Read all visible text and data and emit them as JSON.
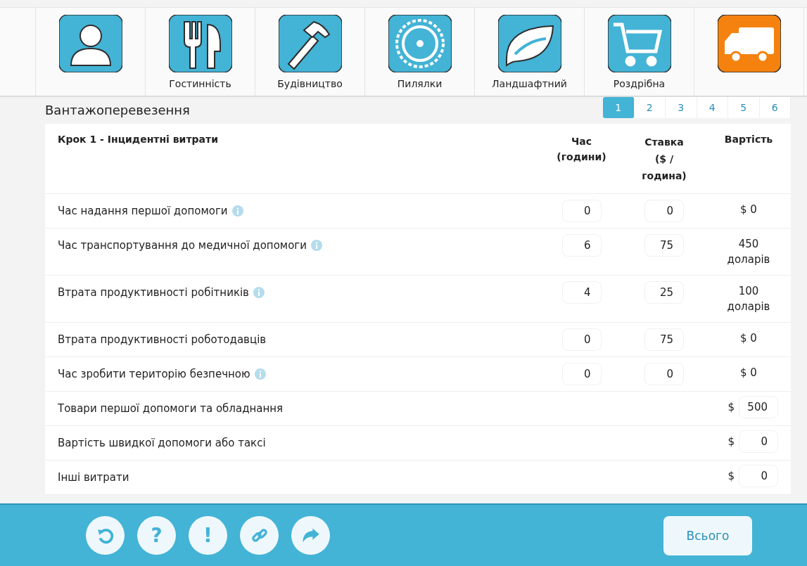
{
  "categories": [
    {
      "selected": false
    },
    {
      "label": "Гостинність",
      "selected": false
    },
    {
      "label": "Будівництво",
      "selected": false
    },
    {
      "label": "Пилялки",
      "selected": false
    },
    {
      "label": "Ландшафтний",
      "selected": false
    },
    {
      "label": "Роздрібна",
      "selected": false
    },
    {
      "selected": true
    }
  ],
  "title": "Вантажоперевезення",
  "pages": [
    {
      "label": "1",
      "selected": true
    },
    {
      "label": "2",
      "selected": false
    },
    {
      "label": "3",
      "selected": false
    },
    {
      "label": "4",
      "selected": false
    },
    {
      "label": "5",
      "selected": false
    },
    {
      "label": "6",
      "selected": false
    }
  ],
  "table": {
    "columns": [
      "Крок 1 - Інцидентні витрати",
      "Час (години)",
      "Ставка ($ / година)",
      "Вартість"
    ],
    "rows": [
      {
        "kind": "hours",
        "label": "Час надання першої допомоги",
        "info": true,
        "hours": "0",
        "rate": "0",
        "cost": "$ 0"
      },
      {
        "kind": "hours",
        "label": "Час транспортування до медичної допомоги",
        "info": true,
        "hours": "6",
        "rate": "75",
        "cost": "450 доларів"
      },
      {
        "kind": "hours",
        "label": "Втрата продуктивності робітників",
        "info": true,
        "hours": "4",
        "rate": "25",
        "cost": "100 доларів"
      },
      {
        "kind": "hours",
        "label": "Втрата продуктивності роботодавців",
        "info": false,
        "hours": "0",
        "rate": "75",
        "cost": "$ 0"
      },
      {
        "kind": "hours",
        "label": "Час зробити територію безпечною",
        "info": true,
        "hours": "0",
        "rate": "0",
        "cost": "$ 0"
      },
      {
        "kind": "amount",
        "label": "Товари першої допомоги та обладнання",
        "info": false,
        "currency": "$",
        "amount": "500"
      },
      {
        "kind": "amount",
        "label": "Вартість швидкої допомоги або таксі",
        "info": false,
        "currency": "$",
        "amount": "0"
      },
      {
        "kind": "amount",
        "label": "Інші витрати",
        "info": false,
        "currency": "$",
        "amount": "0"
      }
    ]
  },
  "footer": {
    "help_button": "?",
    "alert_button": "!",
    "total_button": "Всього"
  }
}
